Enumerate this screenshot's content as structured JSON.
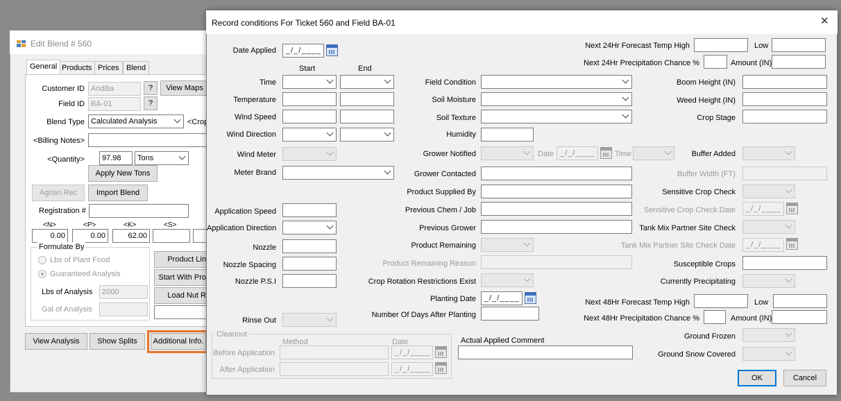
{
  "back_window": {
    "title": "Edit Blend # 560",
    "tabs": [
      "General",
      "Products",
      "Prices",
      "Blend"
    ],
    "customer_id_label": "Customer ID",
    "customer_id": "AndBa",
    "lookup_q": "?",
    "view_maps": "View Maps",
    "field_id_label": "Field ID",
    "field_id": "BA-01",
    "blend_type_label": "Blend Type",
    "blend_type": "Calculated Analysis",
    "crop_label": "<Crop",
    "billing_notes_label": "<Billing Notes>",
    "quantity_label": "<Quantity>",
    "quantity": "97.98",
    "unit": "Tons",
    "apply_new_tons": "Apply New Tons",
    "agrian_rec": "Agrian Rec",
    "import_blend": "Import Blend",
    "registration_label": "Registration #",
    "nutrient_headers": [
      "<N>",
      "<P>",
      "<K>",
      "<S>"
    ],
    "nutrient_values": [
      "0.00",
      "0.00",
      "62.00",
      ""
    ],
    "formulate_by": "Formulate By",
    "lbs_plant_food": "Lbs of Plant Food",
    "guaranteed_analysis": "Guaranteed Analysis",
    "lbs_analysis_label": "Lbs of Analysis",
    "lbs_analysis": "2000",
    "gal_analysis_label": "Gal of Analysis",
    "product_lin": "Product Lin",
    "start_with_pro": "Start With Pro",
    "load_nut_r": "Load Nut R",
    "view_analysis": "View Analysis",
    "show_splits": "Show Splits",
    "additional_info": "Additional Info."
  },
  "dialog": {
    "title": "Record conditions For Ticket 560 and Field BA-01",
    "close": "✕",
    "date_applied": "Date Applied",
    "date_placeholder": "_/_/____",
    "start": "Start",
    "end": "End",
    "time": "Time",
    "temperature": "Temperature",
    "wind_speed": "Wind Speed",
    "wind_direction": "Wind Direction",
    "wind_meter": "Wind Meter",
    "meter_brand": "Meter Brand",
    "application_speed": "Application Speed",
    "application_direction": "Application Direction",
    "nozzle": "Nozzle",
    "nozzle_spacing": "Nozzle Spacing",
    "nozzle_psi": "Nozzle P.S.I",
    "rinse_out": "Rinse Out",
    "cleanout": "Cleanout",
    "method": "Method",
    "date": "Date",
    "before_application": "Before Application",
    "after_application": "After Application",
    "field_condition": "Field Condition",
    "soil_moisture": "Soil Moisture",
    "soil_texture": "Soil Texture",
    "humidity": "Humidity",
    "grower_notified": "Grower Notified",
    "gn_date": "Date",
    "gn_time": "Time",
    "grower_contacted": "Grower Contacted",
    "product_supplied_by": "Product Supplied By",
    "previous_chem_job": "Previous Chem / Job",
    "previous_grower": "Previous Grower",
    "product_remaining": "Product Remaining",
    "product_remaining_reason": "Product Remaining Reason",
    "crop_rotation": "Crop Rotation Restrictions Exist",
    "planting_date": "Planting Date",
    "days_after_planting": "Number Of Days After Planting",
    "actual_applied_comment": "Actual Applied Comment",
    "next24_temp_high": "Next 24Hr Forecast Temp High",
    "low": "Low",
    "next24_precip": "Next 24Hr Precipitation Chance %",
    "amount_in": "Amount (IN)",
    "boom_height": "Boom Height (IN)",
    "weed_height": "Weed Height (IN)",
    "crop_stage": "Crop Stage",
    "buffer_added": "Buffer Added",
    "buffer_width": "Buffer Width (FT)",
    "sensitive_crop_check": "Sensitive Crop Check",
    "sensitive_crop_check_date": "Sensitive Crop Check Date",
    "tank_mix_check": "Tank Mix Partner Site Check",
    "tank_mix_check_date": "Tank Mix Partner Site Check Date",
    "susceptible_crops": "Susceptible Crops",
    "currently_precipitating": "Currently Precipitating",
    "next48_temp_high": "Next 48Hr Forecast Temp High",
    "next48_precip": "Next 48Hr Precipitation Chance %",
    "ground_frozen": "Ground Frozen",
    "ground_snow_covered": "Ground Snow Covered",
    "ok": "OK",
    "cancel": "Cancel"
  },
  "colors": {
    "highlight": "#e8742a",
    "title_bar": "#ffffff",
    "dialog_bg": "#f0f0f0"
  }
}
